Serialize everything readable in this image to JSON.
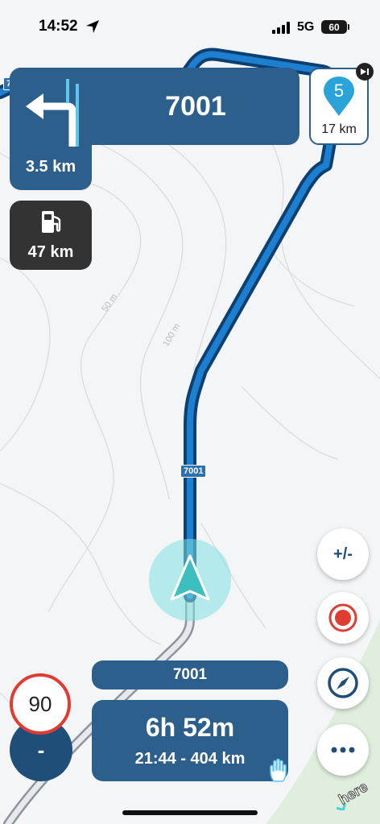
{
  "status_bar": {
    "time": "14:52",
    "network": "5G",
    "battery": "60"
  },
  "map": {
    "road_shields": [
      "7001",
      "7001"
    ],
    "contour_labels": [
      "50 m",
      "100 m"
    ]
  },
  "maneuver": {
    "road_name": "7001",
    "distance": "3.5 km",
    "direction": "turn-left"
  },
  "waypoint": {
    "number": "5",
    "distance": "17 km"
  },
  "fuel": {
    "distance": "47 km"
  },
  "controls": {
    "zoom_label": "+/-"
  },
  "speed": {
    "limit": "90",
    "current": "-"
  },
  "bottom": {
    "road_name": "7001",
    "duration": "6h 52m",
    "details": "21:44 - 404 km"
  },
  "branding": {
    "logo_text": "here"
  },
  "colors": {
    "route": "#0a5fa8",
    "card": "#2d5f8c",
    "speed_limit_ring": "#e03c31",
    "position_arrow": "#3dbfc0"
  }
}
